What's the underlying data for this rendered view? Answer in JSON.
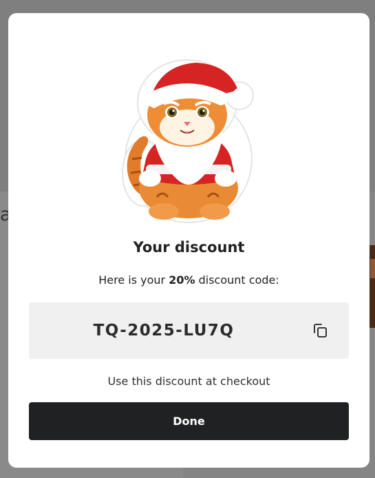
{
  "background": {
    "partial_text": "a"
  },
  "modal": {
    "illustration": "santa-cat-sticker",
    "title": "Your discount",
    "subtitle_prefix": "Here is your ",
    "subtitle_bold": "20%",
    "subtitle_suffix": " discount code:",
    "discount_code": "TQ-2025-LU7Q",
    "copy_icon": "copy-icon",
    "footnote": "Use this discount at checkout",
    "done_label": "Done"
  },
  "colors": {
    "overlay": "#7f7f7f",
    "modal_bg": "#ffffff",
    "code_bg": "#f0f0f0",
    "button_bg": "#202122",
    "button_text": "#ffffff"
  }
}
